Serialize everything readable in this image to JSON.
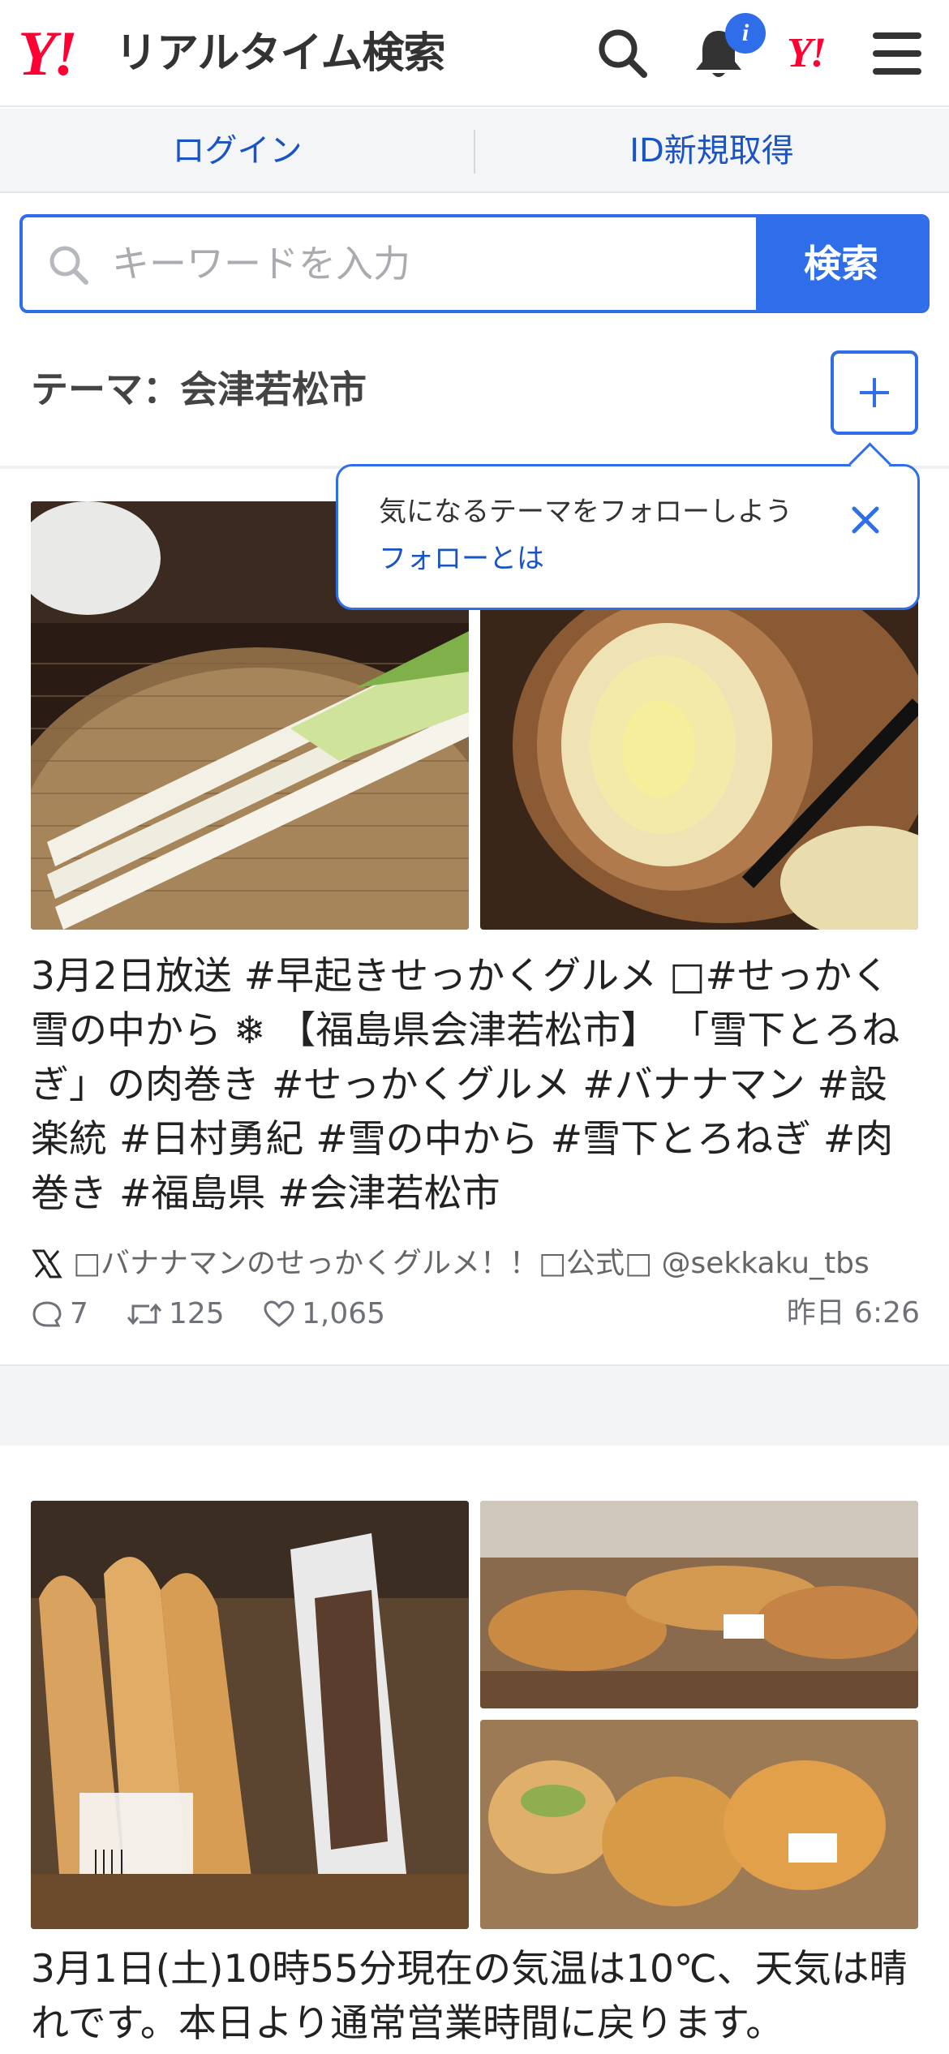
{
  "header": {
    "logo_mark": "Y!",
    "logo_text": "リアルタイム検索",
    "notification_badge": "i",
    "yahoo_mark": "Y!"
  },
  "auth": {
    "login": "ログイン",
    "signup": "ID新規取得"
  },
  "search": {
    "placeholder": "キーワードを入力",
    "button": "検索"
  },
  "theme": {
    "title": "テーマ：会津若松市"
  },
  "tooltip": {
    "message": "気になるテーマをフォローしよう",
    "link": "フォローとは"
  },
  "posts": [
    {
      "text": "3月2日放送 #早起きせっかくグルメ □#せっかく雪の中から ❄ 【福島県会津若松市】 「雪下とろねぎ」の肉巻き #せっかくグルメ #バナナマン #設楽統 #日村勇紀 #雪の中から #雪下とろねぎ #肉巻き #福島県 #会津若松市",
      "author": "□バナナマンのせっかくグルメ！！□公式□ @sekkaku_tbs",
      "replies": "7",
      "retweets": "125",
      "likes": "1,065",
      "time": "昨日 6:26"
    },
    {
      "text": "3月1日(土)10時55分現在の気温は10℃、天気は晴れです。本日より通常営業時間に戻ります。"
    }
  ],
  "colors": {
    "accent": "#2f6ee8",
    "brand_red": "#ff0033",
    "link": "#1a54c4"
  }
}
